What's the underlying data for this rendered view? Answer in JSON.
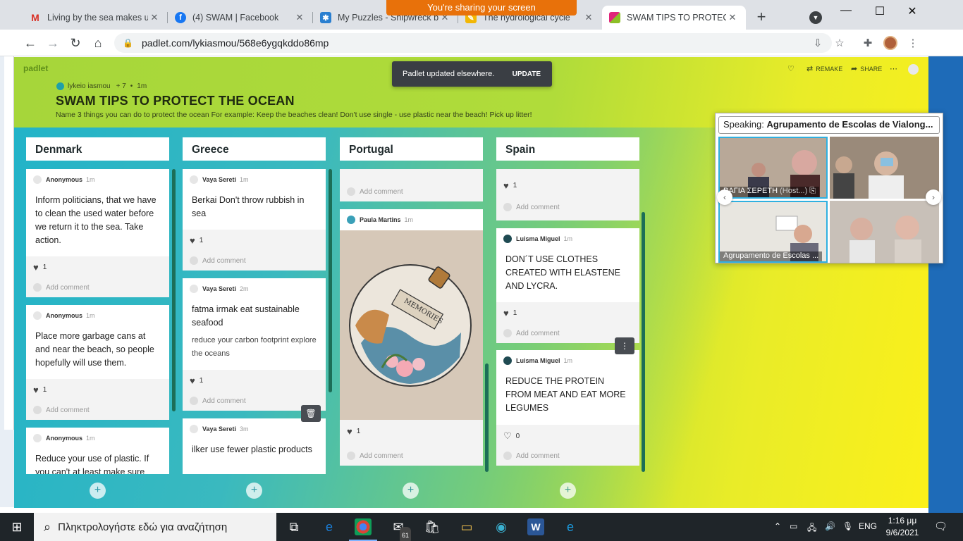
{
  "browser": {
    "share_banner": "You're sharing your screen",
    "tabs": [
      {
        "title": "Living by the sea makes us",
        "icon": "gmail-icon",
        "color": "#d93025"
      },
      {
        "title": "(4) SWAM | Facebook",
        "icon": "facebook-icon",
        "color": "#1877f2"
      },
      {
        "title": "My Puzzles - Shipwreck be",
        "icon": "puzzle-icon",
        "color": "#2a7fd0"
      },
      {
        "title": "The hydrological cycle",
        "icon": "note-icon",
        "color": "#f2b705"
      },
      {
        "title": "SWAM TIPS TO PROTECT T",
        "icon": "padlet-icon",
        "color": "#8cbf26"
      }
    ],
    "url": "padlet.com/lykiasmou/568e6ygqkddo86mp"
  },
  "padlet": {
    "logo": "padlet",
    "author": "lykeio iasmou",
    "likes": "+ 7",
    "time": "1m",
    "title": "SWAM TIPS TO PROTECT THE OCEAN",
    "description": "Name 3 things you can do to protect the ocean For example: Keep the beaches clean! Don't use single - use plastic near the beach! Pick up litter!",
    "toast_text": "Padlet updated elsewhere.",
    "toast_action": "UPDATE",
    "remake": "REMAKE",
    "share": "SHARE",
    "add_comment": "Add comment",
    "columns": [
      {
        "name": "Denmark",
        "cards": [
          {
            "author": "Anonymous",
            "time": "1m",
            "text": "Inform politicians, that we have to clean the used water before we return it to the sea. Take action.",
            "likes": "1"
          },
          {
            "author": "Anonymous",
            "time": "1m",
            "text": "Place more garbage cans at and near the beach, so people hopefully will use them.",
            "likes": "1"
          },
          {
            "author": "Anonymous",
            "time": "1m",
            "text": "Reduce your use of plastic. If you can't at least make sure"
          }
        ]
      },
      {
        "name": "Greece",
        "cards": [
          {
            "author": "Vaya Sereti",
            "time": "1m",
            "text": "Berkai Don't throw rubbish in sea",
            "likes": "1"
          },
          {
            "author": "Vaya Sereti",
            "time": "2m",
            "text": "fatma irmak eat sustainable seafood",
            "sub": "reduce your carbon footprint explore the oceans",
            "likes": "1"
          },
          {
            "author": "Vaya Sereti",
            "time": "3m",
            "text": "ilker use fewer plastic products"
          }
        ]
      },
      {
        "name": "Portugal",
        "cards": [
          {
            "author": "Paula Martins",
            "time": "1m",
            "likes": "1",
            "image_text": "MEMORIES"
          }
        ]
      },
      {
        "name": "Spain",
        "cards": [
          {
            "likes": "1"
          },
          {
            "author": "Luisma Miguel",
            "time": "1m",
            "text": "DON´T USE CLOTHES CREATED WITH ELASTENE AND LYCRA.",
            "likes": "1"
          },
          {
            "author": "Luisma Miguel",
            "time": "1m",
            "text": "REDUCE THE PROTEIN FROM MEAT AND EAT MORE LEGUMES",
            "likes": "0"
          }
        ]
      }
    ]
  },
  "zoom": {
    "speaking_label": "Speaking:",
    "speaking_name": "Agrupamento de Escolas de Vialong...",
    "participant1": "ΒΑΓΙΑ ΣΕΡΕΤΗ",
    "host_tag": "(Host...)",
    "participant2": "Agrupamento de Escolas ..."
  },
  "taskbar": {
    "search_placeholder": "Πληκτρολογήστε εδώ για αναζήτηση",
    "mail_badge": "61",
    "lang": "ENG",
    "time": "1:16 μμ",
    "date": "9/6/2021"
  }
}
